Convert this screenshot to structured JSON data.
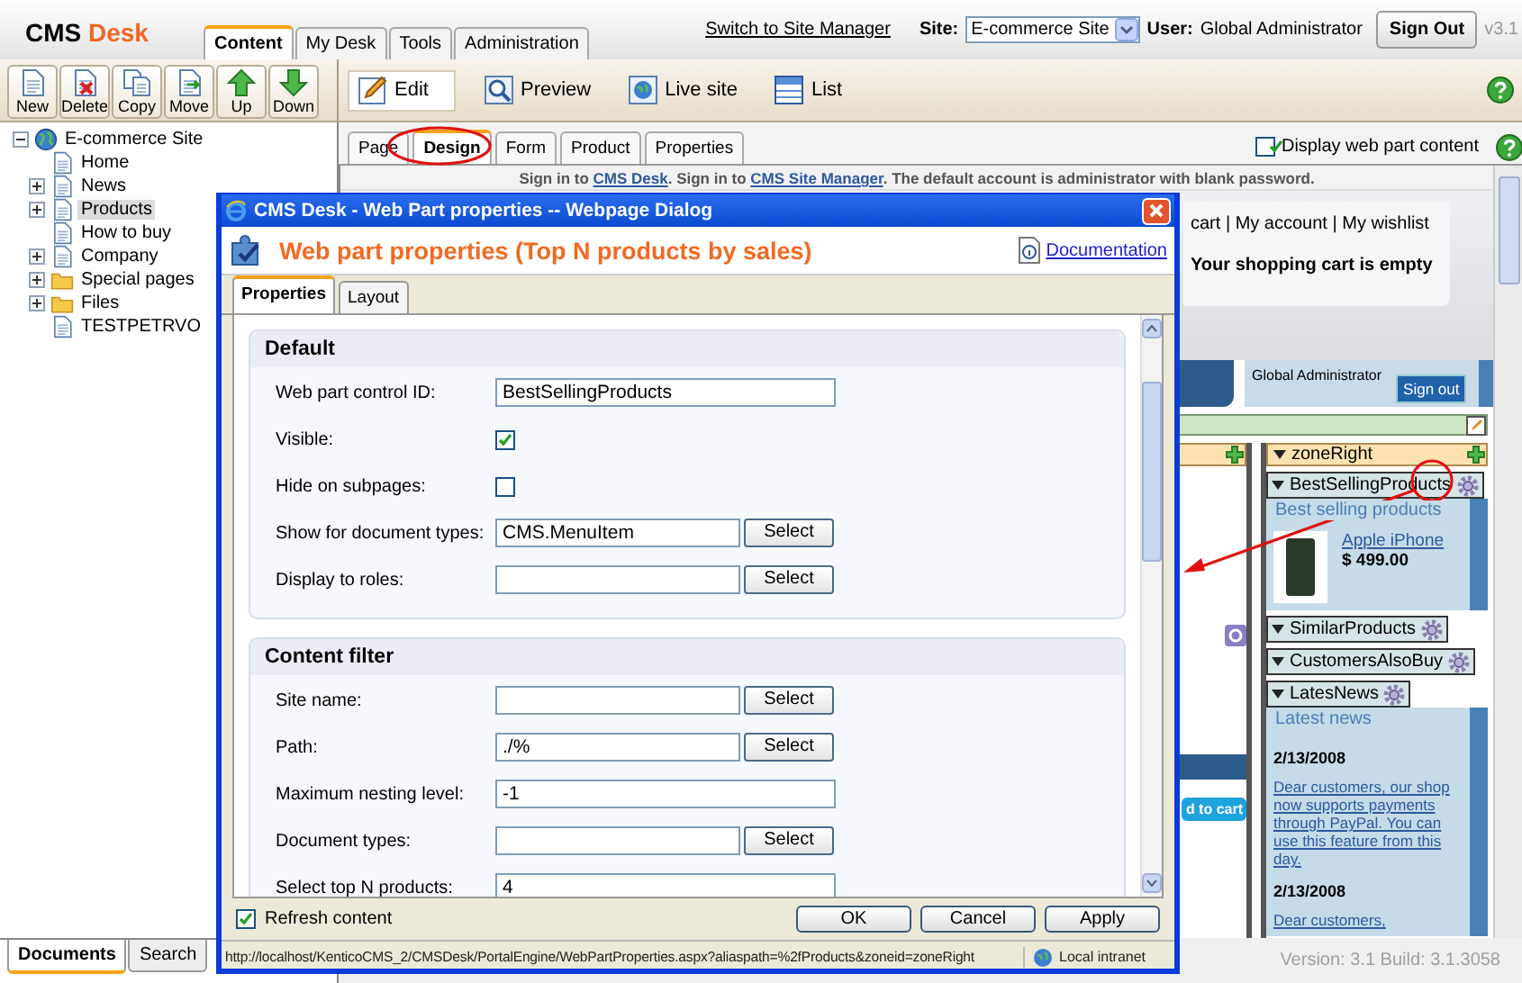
{
  "header": {
    "logo": {
      "brand": "CMS",
      "product": "Desk"
    },
    "tabs": [
      {
        "label": "Content",
        "selected": true
      },
      {
        "label": "My Desk",
        "selected": false
      },
      {
        "label": "Tools",
        "selected": false
      },
      {
        "label": "Administration",
        "selected": false
      }
    ],
    "switch_link": "Switch to Site Manager",
    "site_label": "Site:",
    "site_value": "E-commerce Site",
    "user_label": "User:",
    "user_name": "Global Administrator",
    "sign_out": "Sign Out",
    "version_badge": "v3.1"
  },
  "toolbar": [
    {
      "label": "New",
      "kind": "new"
    },
    {
      "label": "Delete",
      "kind": "delete"
    },
    {
      "label": "Copy",
      "kind": "copy"
    },
    {
      "label": "Move",
      "kind": "move"
    },
    {
      "label": "Up",
      "kind": "up"
    },
    {
      "label": "Down",
      "kind": "down"
    }
  ],
  "edit_toolbar": [
    {
      "label": "Edit",
      "kind": "edit",
      "selected": true
    },
    {
      "label": "Preview",
      "kind": "preview",
      "selected": false
    },
    {
      "label": "Live site",
      "kind": "live",
      "selected": false
    },
    {
      "label": "List",
      "kind": "list",
      "selected": false
    }
  ],
  "tree": {
    "label": "E-commerce Site",
    "kind": "site",
    "expanded": true,
    "selected": false,
    "children": [
      {
        "label": "Home",
        "kind": "page",
        "selected": false
      },
      {
        "label": "News",
        "kind": "page",
        "expanded": false,
        "selected": false
      },
      {
        "label": "Products",
        "kind": "page",
        "expanded": false,
        "selected": true
      },
      {
        "label": "How to buy",
        "kind": "page",
        "selected": false
      },
      {
        "label": "Company",
        "kind": "page",
        "expanded": false,
        "selected": false
      },
      {
        "label": "Special pages",
        "kind": "folder",
        "expanded": false,
        "selected": false
      },
      {
        "label": "Files",
        "kind": "folder",
        "expanded": false,
        "selected": false
      },
      {
        "label": "TESTPETRVO",
        "kind": "page",
        "selected": false
      }
    ]
  },
  "bottom_tabs": [
    {
      "label": "Documents",
      "selected": true
    },
    {
      "label": "Search",
      "selected": false
    }
  ],
  "page_tabs": [
    {
      "label": "Page",
      "selected": false
    },
    {
      "label": "Design",
      "selected": true
    },
    {
      "label": "Form",
      "selected": false
    },
    {
      "label": "Product",
      "selected": false
    },
    {
      "label": "Properties",
      "selected": false
    }
  ],
  "display_webpart_content": {
    "label": "Display web part content",
    "checked": true
  },
  "preview": {
    "notice": [
      {
        "text": "Sign in to ",
        "kind": "text"
      },
      {
        "text": "CMS Desk",
        "kind": "link"
      },
      {
        "text": ". Sign in to ",
        "kind": "text"
      },
      {
        "text": "CMS Site Manager",
        "kind": "link"
      },
      {
        "text": ". The default account is administrator with blank password.",
        "kind": "text"
      }
    ],
    "top_links": "cart | My account | My wishlist",
    "cart_status": "Your shopping cart is empty",
    "user_name": "Global Administrator",
    "sign_out": "Sign out",
    "add_to_cart": "d to cart",
    "zone": {
      "name": "zoneRight",
      "webparts": [
        {
          "name": "BestSellingProducts",
          "title": "Best selling products",
          "products": [
            {
              "name": "Apple iPhone",
              "price": "$ 499.00"
            }
          ]
        },
        {
          "name": "SimilarProducts"
        },
        {
          "name": "CustomersAlsoBuy"
        },
        {
          "name": "LatesNews",
          "title": "Latest news",
          "news": [
            {
              "date": "2/13/2008",
              "text": "Dear customers, our shop now supports payments through PayPal. You can use this feature from this day."
            },
            {
              "date": "2/13/2008",
              "text": "Dear customers,"
            }
          ]
        }
      ]
    }
  },
  "version": "Version: 3.1 Build: 3.1.3058",
  "dialog": {
    "title": "CMS Desk - Web Part properties -- Webpage Dialog",
    "heading": "Web part properties (Top N products by sales)",
    "documentation": "Documentation",
    "tabs": [
      {
        "label": "Properties",
        "selected": true
      },
      {
        "label": "Layout",
        "selected": false
      }
    ],
    "sections": [
      {
        "title": "Default",
        "fields": [
          {
            "label": "Web part control ID:",
            "kind": "text",
            "value": "BestSellingProducts"
          },
          {
            "label": "Visible:",
            "kind": "checkbox",
            "checked": true
          },
          {
            "label": "Hide on subpages:",
            "kind": "checkbox",
            "checked": false
          },
          {
            "label": "Show for document types:",
            "kind": "select",
            "value": "CMS.MenuItem",
            "button": "Select"
          },
          {
            "label": "Display to roles:",
            "kind": "select",
            "button": "Select"
          }
        ]
      },
      {
        "title": "Content filter",
        "fields": [
          {
            "label": "Site name:",
            "kind": "select",
            "button": "Select"
          },
          {
            "label": "Path:",
            "kind": "select",
            "value": "./%",
            "button": "Select"
          },
          {
            "label": "Maximum nesting level:",
            "kind": "text",
            "value": "-1"
          },
          {
            "label": "Document types:",
            "kind": "select",
            "button": "Select"
          },
          {
            "label": "Select top N products:",
            "kind": "text",
            "value": "4"
          }
        ]
      }
    ],
    "refresh": {
      "label": "Refresh content",
      "checked": true
    },
    "buttons": [
      "OK",
      "Cancel",
      "Apply"
    ],
    "status_url": "http://localhost/KenticoCMS_2/CMSDesk/PortalEngine/WebPartProperties.aspx?aliaspath=%2fProducts&zoneid=zoneRight",
    "status_zone": "Local intranet"
  }
}
